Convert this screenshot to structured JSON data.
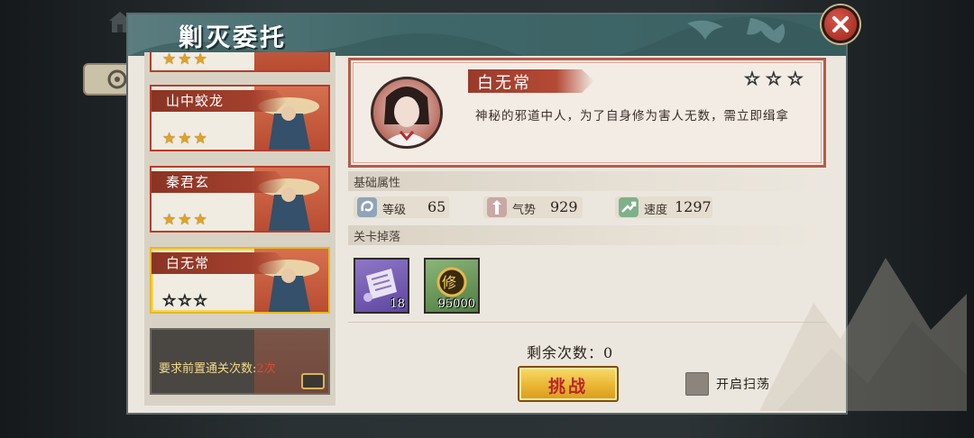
{
  "window": {
    "title": "剿灭委托"
  },
  "stages": [
    {
      "name": "",
      "stars_filled": 3,
      "stars_text": "★★★"
    },
    {
      "name": "山中蛟龙",
      "stars_filled": 3,
      "stars_text": "★★★"
    },
    {
      "name": "秦君玄",
      "stars_filled": 3,
      "stars_text": "★★★"
    },
    {
      "name": "白无常",
      "stars_filled": 0,
      "stars_text": "☆☆☆",
      "selected": true
    }
  ],
  "locked_stage": {
    "requirement_label": "要求前置通关次数:",
    "requirement_value": "2次"
  },
  "boss": {
    "name": "白无常",
    "stars_text": "☆☆☆",
    "stars_filled": 0,
    "description": "神秘的邪道中人，为了自身修为害人无数，需立即缉拿"
  },
  "attributes": {
    "section_title": "基础属性",
    "items": [
      {
        "label": "等级",
        "value": "65",
        "icon": "level-icon"
      },
      {
        "label": "气势",
        "value": "929",
        "icon": "momentum-icon"
      },
      {
        "label": "速度",
        "value": "1297",
        "icon": "speed-icon"
      }
    ]
  },
  "drops": {
    "section_title": "关卡掉落",
    "items": [
      {
        "icon": "scroll-icon",
        "quantity": "18"
      },
      {
        "icon": "cultivation-coin-icon",
        "quantity": "95000",
        "coin_glyph": "修"
      }
    ]
  },
  "remaining": {
    "label": "剩余次数：0"
  },
  "actions": {
    "challenge_label": "挑战",
    "sweep_label": "开启扫荡"
  },
  "colors": {
    "accent_red": "#b73d2a",
    "header_teal": "#3f6668",
    "gold": "#e9b632"
  }
}
